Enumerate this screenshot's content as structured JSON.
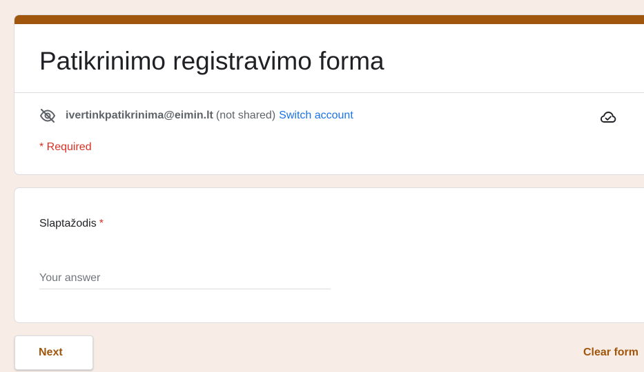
{
  "form": {
    "title": "Patikrinimo registravimo forma",
    "accent_color": "#a0560c",
    "background_color": "#f7ede6"
  },
  "account": {
    "visibility_icon": "eye-off-icon",
    "email": "ivertinkpatikrinima@eimin.lt",
    "shared_status": "(not shared)",
    "switch_label": "Switch account",
    "save_status_icon": "cloud-done-icon"
  },
  "required_note": "* Required",
  "question": {
    "title": "Slaptažodis",
    "required_marker": "*",
    "placeholder": "Your answer",
    "value": ""
  },
  "footer": {
    "next_label": "Next",
    "clear_label": "Clear form"
  }
}
